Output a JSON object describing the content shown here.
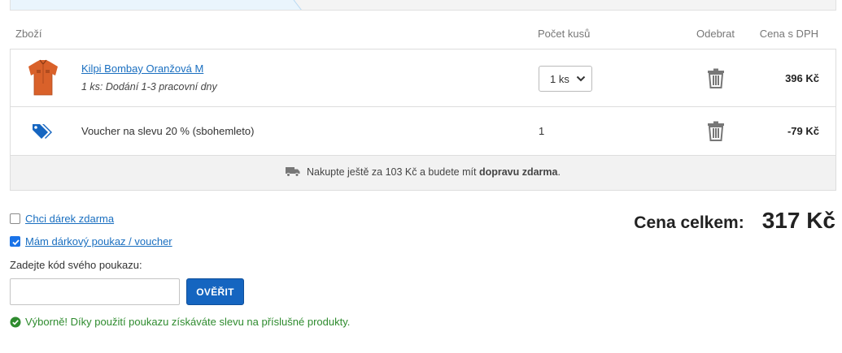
{
  "header": {
    "goods": "Zboží",
    "quantity": "Počet kusů",
    "remove": "Odebrat",
    "price_vat": "Cena s DPH"
  },
  "items": [
    {
      "name": "Kilpi Bombay Oranžová M",
      "delivery": "1 ks: Dodání 1-3 pracovní dny",
      "quantity": "1 ks",
      "price": "396 Kč",
      "thumbnail_color": "#d9612a"
    }
  ],
  "voucher_row": {
    "name": "Voucher na slevu 20 % (sbohemleto)",
    "quantity": "1",
    "price": "-79 Kč",
    "icon": "tag-icon"
  },
  "shipping": {
    "text_before": "Nakupte ještě za 103 Kč a budete mít ",
    "text_bold": "dopravu zdarma",
    "text_after": ".",
    "icon": "truck-icon"
  },
  "options": {
    "gift": {
      "label": "Chci dárek zdarma",
      "checked": false
    },
    "voucher": {
      "label": "Mám dárkový poukaz / voucher",
      "checked": true
    }
  },
  "voucher_form": {
    "label": "Zadejte kód svého poukazu:",
    "value": "",
    "button": "OVĚŘIT"
  },
  "success_message": "Výborně! Díky použití poukazu získáváte slevu na příslušné produkty.",
  "total": {
    "label": "Cena celkem:",
    "value": "317 Kč"
  },
  "colors": {
    "link": "#1a6fc0",
    "primary_button": "#1565c0",
    "success": "#2e8b2e",
    "checkbox": "#1a73e8"
  }
}
